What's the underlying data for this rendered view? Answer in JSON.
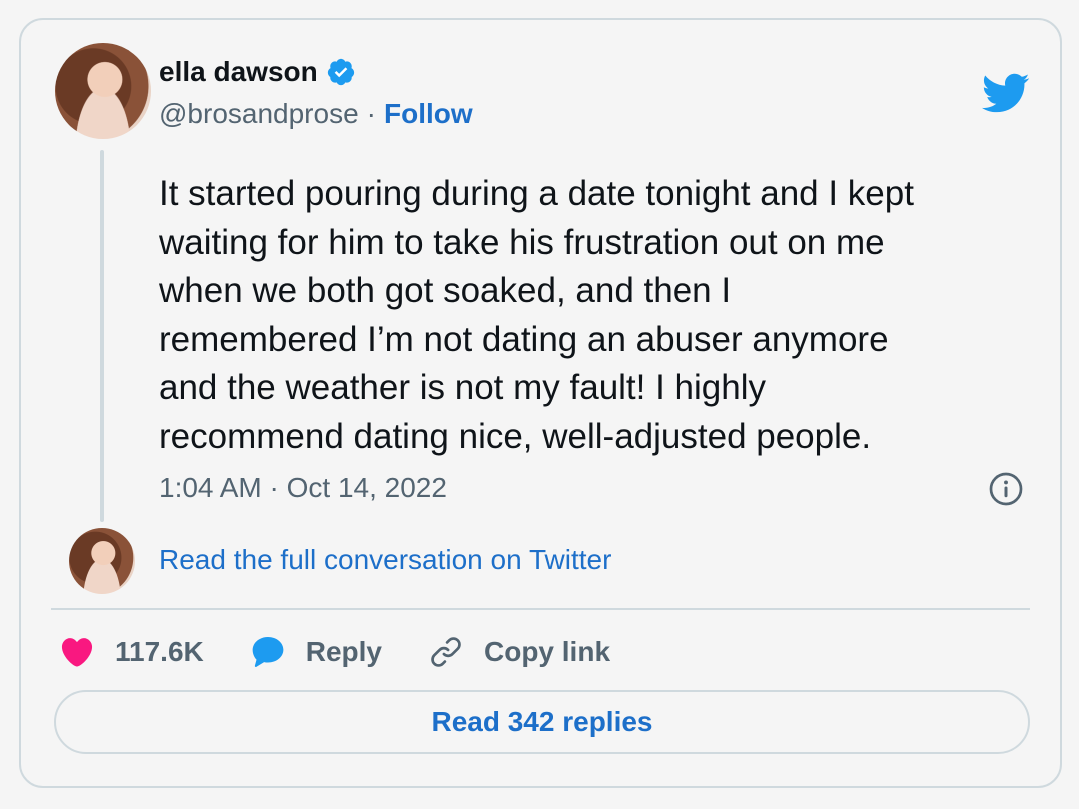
{
  "author": {
    "name": "ella dawson",
    "handle": "@brosandprose",
    "separator": "·",
    "follow_label": "Follow",
    "verified": true
  },
  "tweet": {
    "text": "It started pouring during a date tonight and I kept\nwaiting for him to take his frustration out on me\nwhen we both got soaked, and then I\nremembered I’m not dating an abuser anymore\nand the weather is not my fault! I highly\nrecommend dating nice, well-adjusted people.",
    "timestamp": "1:04 AM · Oct 14, 2022"
  },
  "conversation_link": "Read the full conversation on Twitter",
  "actions": {
    "likes": "117.6K",
    "reply_label": "Reply",
    "copy_label": "Copy link"
  },
  "replies_button": "Read 342 replies",
  "icons": {
    "brand": "twitter-bird-icon",
    "verified": "verified-badge-icon",
    "info": "info-icon",
    "like": "heart-icon",
    "reply": "speech-bubble-icon",
    "copy": "link-icon"
  },
  "colors": {
    "accent": "#1d6fc9",
    "twitter_blue": "#1d9bf0",
    "like_pink": "#f91880",
    "border": "#cfd9de",
    "muted": "#536471"
  }
}
